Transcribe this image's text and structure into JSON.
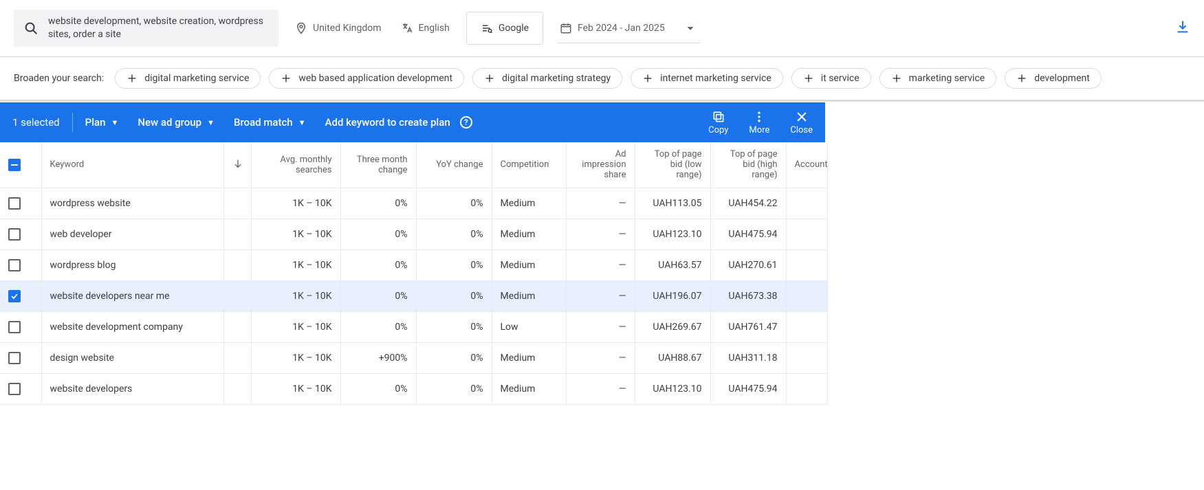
{
  "toolbar": {
    "search_text": "website development, website creation, wordpress sites, order a site",
    "location": "United Kingdom",
    "language": "English",
    "network": "Google",
    "date_range": "Feb 2024 - Jan 2025"
  },
  "broaden": {
    "label": "Broaden your search:",
    "chips": [
      "digital marketing service",
      "web based application development",
      "digital marketing strategy",
      "internet marketing service",
      "it service",
      "marketing service",
      "development"
    ]
  },
  "selection_bar": {
    "count_label": "1 selected",
    "plan": "Plan",
    "adgroup": "New ad group",
    "match": "Broad match",
    "add": "Add keyword to create plan",
    "copy": "Copy",
    "more": "More",
    "close": "Close"
  },
  "columns": {
    "keyword": "Keyword",
    "avg": "Avg. monthly searches",
    "three_month": "Three month change",
    "yoy": "YoY change",
    "competition": "Competition",
    "impression": "Ad impression share",
    "bid_low": "Top of page bid (low range)",
    "bid_high": "Top of page bid (high range)",
    "account": "Account"
  },
  "rows": [
    {
      "selected": false,
      "keyword": "wordpress website",
      "avg": "1K – 10K",
      "three_month": "0%",
      "yoy": "0%",
      "competition": "Medium",
      "impression": "—",
      "bid_low": "UAH113.05",
      "bid_high": "UAH454.22"
    },
    {
      "selected": false,
      "keyword": "web developer",
      "avg": "1K – 10K",
      "three_month": "0%",
      "yoy": "0%",
      "competition": "Medium",
      "impression": "—",
      "bid_low": "UAH123.10",
      "bid_high": "UAH475.94"
    },
    {
      "selected": false,
      "keyword": "wordpress blog",
      "avg": "1K – 10K",
      "three_month": "0%",
      "yoy": "0%",
      "competition": "Medium",
      "impression": "—",
      "bid_low": "UAH63.57",
      "bid_high": "UAH270.61"
    },
    {
      "selected": true,
      "keyword": "website developers near me",
      "avg": "1K – 10K",
      "three_month": "0%",
      "yoy": "0%",
      "competition": "Medium",
      "impression": "—",
      "bid_low": "UAH196.07",
      "bid_high": "UAH673.38"
    },
    {
      "selected": false,
      "keyword": "website development company",
      "avg": "1K – 10K",
      "three_month": "0%",
      "yoy": "0%",
      "competition": "Low",
      "impression": "—",
      "bid_low": "UAH269.67",
      "bid_high": "UAH761.47"
    },
    {
      "selected": false,
      "keyword": "design website",
      "avg": "1K – 10K",
      "three_month": "+900%",
      "yoy": "0%",
      "competition": "Medium",
      "impression": "—",
      "bid_low": "UAH88.67",
      "bid_high": "UAH311.18"
    },
    {
      "selected": false,
      "keyword": "website developers",
      "avg": "1K – 10K",
      "three_month": "0%",
      "yoy": "0%",
      "competition": "Medium",
      "impression": "—",
      "bid_low": "UAH123.10",
      "bid_high": "UAH475.94"
    }
  ]
}
